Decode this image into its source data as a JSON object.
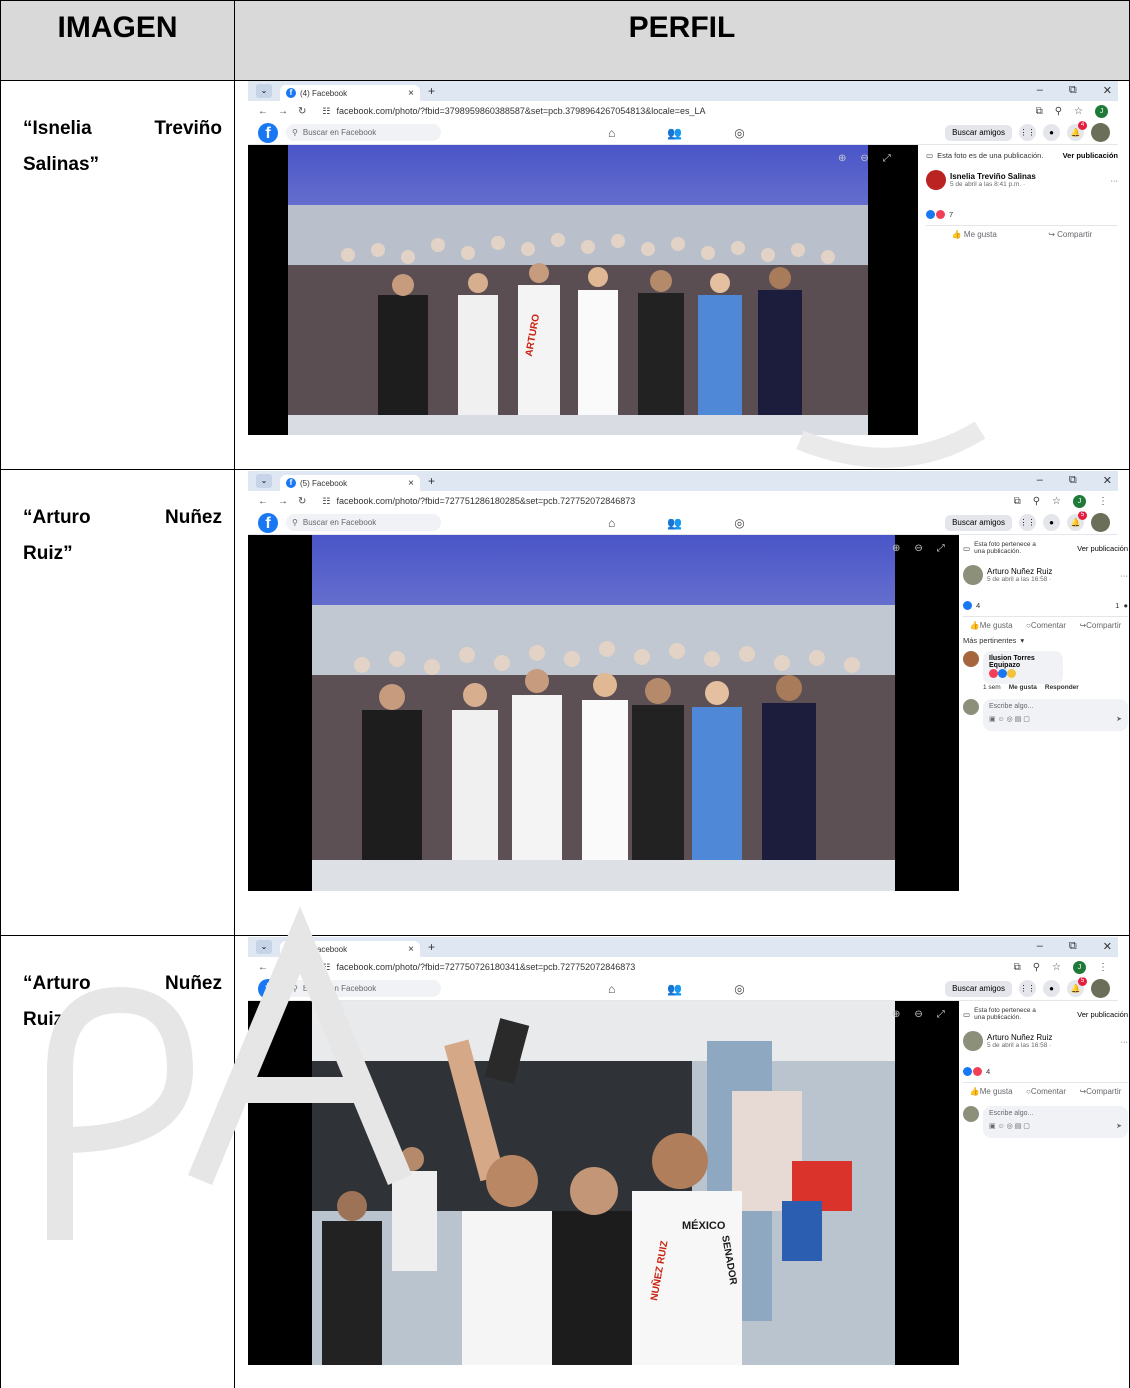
{
  "table": {
    "header_col1": "IMAGEN",
    "header_col2": "PERFIL",
    "rows": [
      {
        "name_word1": "“Isnelia",
        "name_word2": "Treviño",
        "name_line2": "Salinas”"
      },
      {
        "name_word1": "“Arturo",
        "name_word2": "Nuñez",
        "name_line2": "Ruiz”"
      },
      {
        "name_word1": "“Arturo",
        "name_word2": "Nuñez",
        "name_line2": "Ruiz”"
      }
    ]
  },
  "shots": [
    {
      "tab_title": "(4) Facebook",
      "url": "facebook.com/photo/?fbid=379895986038858​7&set=pcb.3798964267054813&locale=es_LA",
      "search_placeholder": "Buscar en Facebook",
      "buscar_amigos": "Buscar amigos",
      "notif_count": "4",
      "belongs_text": "Esta foto es de una publicación.",
      "ver_publicacion": "Ver publicación",
      "author": "Isnelia Treviño Salinas",
      "date": "5 de abril a las 8:41 p.m. · ",
      "reaction_count": "7",
      "like": "Me gusta",
      "share": "Compartir"
    },
    {
      "tab_title": "(5) Facebook",
      "url": "facebook.com/photo/?fbid=727751286180285&set=pcb.727752072846873",
      "search_placeholder": "Buscar en Facebook",
      "buscar_amigos": "Buscar amigos",
      "notif_count": "5",
      "belongs_text": "Esta foto pertenece a una publicación.",
      "ver_publicacion": "Ver publicación",
      "author": "Arturo Nuñez Ruiz",
      "date": "5 de abril a las 16:58 · ",
      "reaction_count": "4",
      "comment_count": "1",
      "like": "Me gusta",
      "comment": "Comentar",
      "share": "Compartir",
      "mas_pertinentes": "Más pertinentes",
      "commenter": "Ilusion Torres Equipazo",
      "comment_time": "1 sem",
      "comment_like": "Me gusta",
      "comment_reply": "Responder",
      "write_placeholder": "Escribe algo..."
    },
    {
      "tab_title": "(5) Facebook",
      "url": "facebook.com/photo/?fbid=727750726180341&set=pcb.727752072846873",
      "search_placeholder": "Buscar en Facebook",
      "buscar_amigos": "Buscar amigos",
      "notif_count": "5",
      "belongs_text": "Esta foto pertenece a una publicación.",
      "ver_publicacion": "Ver publicación",
      "author": "Arturo Nuñez Ruiz",
      "date": "5 de abril a las 16:58 · ",
      "reaction_count": "4",
      "like": "Me gusta",
      "comment": "Comentar",
      "share": "Compartir",
      "write_placeholder": "Escribe algo..."
    }
  ],
  "photo_text": {
    "shirt_name": "ARTURO",
    "shirt_surname": "NUÑEZ RUIZ",
    "shirt_party": "MÉXICO",
    "shirt_role": "SENADOR"
  },
  "icons": [
    "facebook-logo-icon",
    "search-icon",
    "home-icon",
    "friends-icon",
    "groups-icon",
    "grid-menu-icon",
    "messenger-icon",
    "bell-icon",
    "zoom-in-icon",
    "zoom-out-icon",
    "fullscreen-icon",
    "more-icon",
    "like-icon",
    "comment-icon",
    "share-icon"
  ],
  "colors": {
    "facebook_blue": "#1877f2",
    "header_gray": "#d9d9d9",
    "tab_bar": "#dfe7f3"
  }
}
